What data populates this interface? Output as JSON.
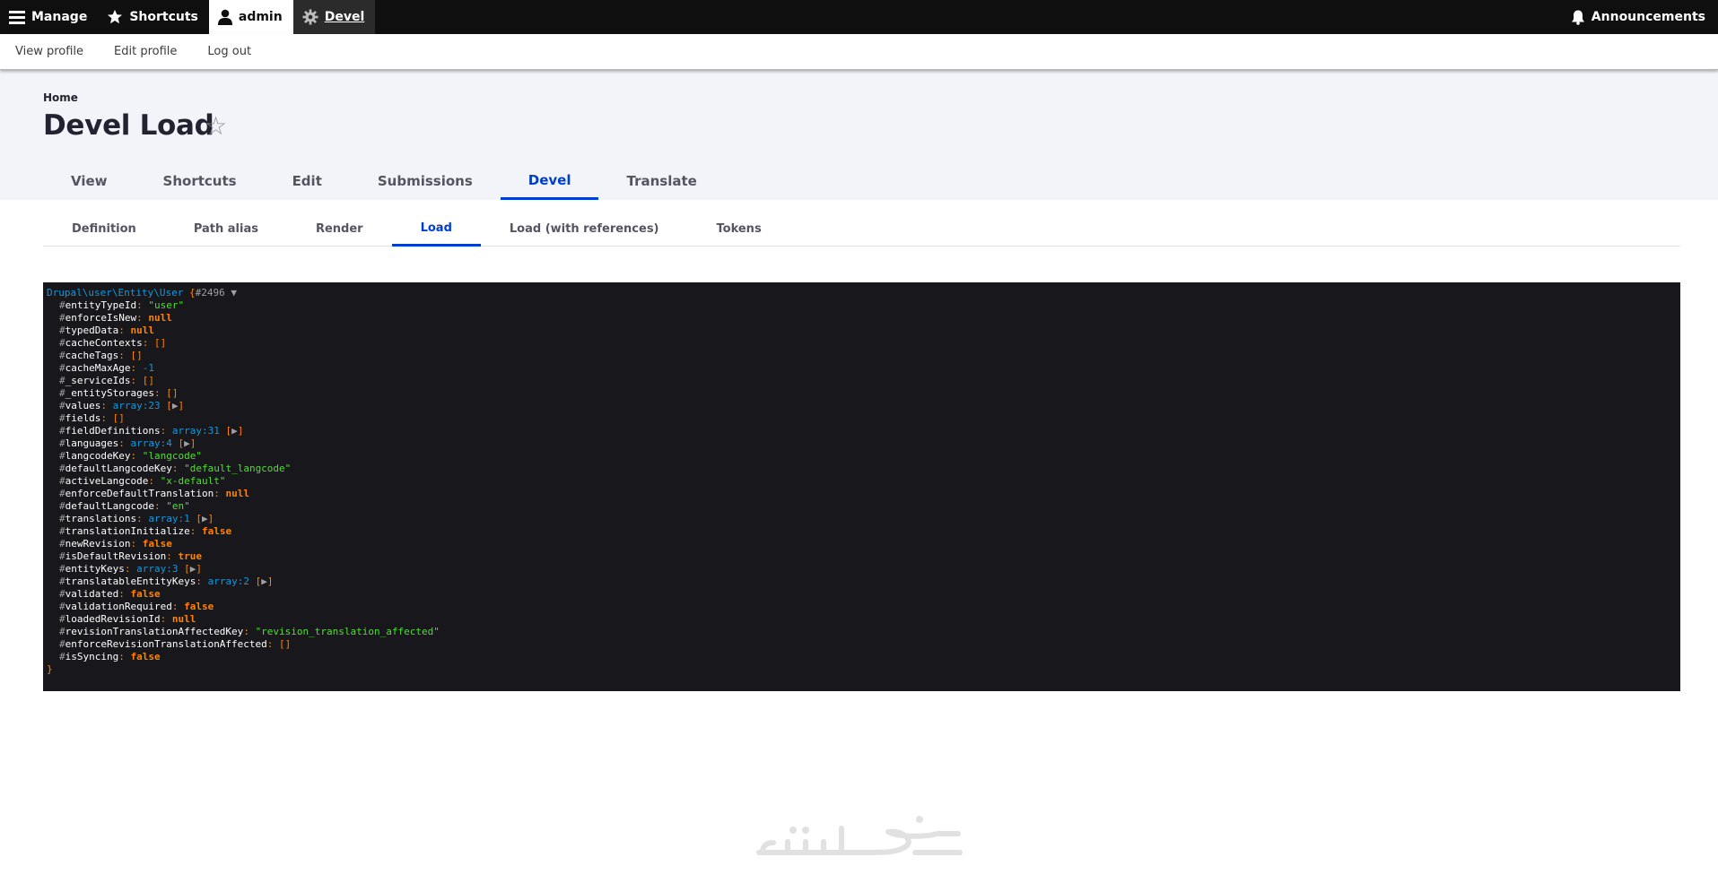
{
  "toolbar": {
    "manage": "Manage",
    "shortcuts": "Shortcuts",
    "user": "admin",
    "devel": "Devel",
    "announcements": "Announcements"
  },
  "tray": {
    "view_profile": "View profile",
    "edit_profile": "Edit profile",
    "log_out": "Log out"
  },
  "breadcrumb": "Home",
  "page_title": "Devel Load",
  "primary_tabs": [
    "View",
    "Shortcuts",
    "Edit",
    "Submissions",
    "Devel",
    "Translate"
  ],
  "primary_active": "Devel",
  "secondary_tabs": [
    "Definition",
    "Path alias",
    "Render",
    "Load",
    "Load (with references)",
    "Tokens"
  ],
  "secondary_active": "Load",
  "dump": {
    "class": "Drupal\\user\\Entity\\User",
    "open": "{",
    "id": "#2496",
    "close": "}",
    "properties": [
      {
        "key": "entityTypeId",
        "type": "str",
        "value": "\"user\""
      },
      {
        "key": "enforceIsNew",
        "type": "const",
        "value": "null"
      },
      {
        "key": "typedData",
        "type": "const",
        "value": "null"
      },
      {
        "key": "cacheContexts",
        "type": "punct",
        "value": "[]"
      },
      {
        "key": "cacheTags",
        "type": "punct",
        "value": "[]"
      },
      {
        "key": "cacheMaxAge",
        "type": "num",
        "value": "-1"
      },
      {
        "key": "_serviceIds",
        "type": "punct",
        "value": "[]"
      },
      {
        "key": "_entityStorages",
        "type": "punct",
        "value": "[]"
      },
      {
        "key": "values",
        "type": "arr",
        "value": "array:23"
      },
      {
        "key": "fields",
        "type": "punct",
        "value": "[]"
      },
      {
        "key": "fieldDefinitions",
        "type": "arr",
        "value": "array:31"
      },
      {
        "key": "languages",
        "type": "arr",
        "value": "array:4"
      },
      {
        "key": "langcodeKey",
        "type": "str",
        "value": "\"langcode\""
      },
      {
        "key": "defaultLangcodeKey",
        "type": "str",
        "value": "\"default_langcode\""
      },
      {
        "key": "activeLangcode",
        "type": "str",
        "value": "\"x-default\""
      },
      {
        "key": "enforceDefaultTranslation",
        "type": "const",
        "value": "null"
      },
      {
        "key": "defaultLangcode",
        "type": "str",
        "value": "\"en\""
      },
      {
        "key": "translations",
        "type": "arr",
        "value": "array:1"
      },
      {
        "key": "translationInitialize",
        "type": "const",
        "value": "false"
      },
      {
        "key": "newRevision",
        "type": "const",
        "value": "false"
      },
      {
        "key": "isDefaultRevision",
        "type": "const",
        "value": "true"
      },
      {
        "key": "entityKeys",
        "type": "arr",
        "value": "array:3"
      },
      {
        "key": "translatableEntityKeys",
        "type": "arr",
        "value": "array:2"
      },
      {
        "key": "validated",
        "type": "const",
        "value": "false"
      },
      {
        "key": "validationRequired",
        "type": "const",
        "value": "false"
      },
      {
        "key": "loadedRevisionId",
        "type": "const",
        "value": "null"
      },
      {
        "key": "revisionTranslationAffectedKey",
        "type": "str",
        "value": "\"revision_translation_affected\""
      },
      {
        "key": "enforceRevisionTranslationAffected",
        "type": "punct",
        "value": "[]"
      },
      {
        "key": "isSyncing",
        "type": "const",
        "value": "false"
      }
    ]
  },
  "watermark": "خمسات",
  "colors": {
    "accent": "#003ecc",
    "toolbar_bg": "#0f0f0f",
    "header_bg": "#f3f4f9",
    "dump_bg": "#18171b"
  }
}
